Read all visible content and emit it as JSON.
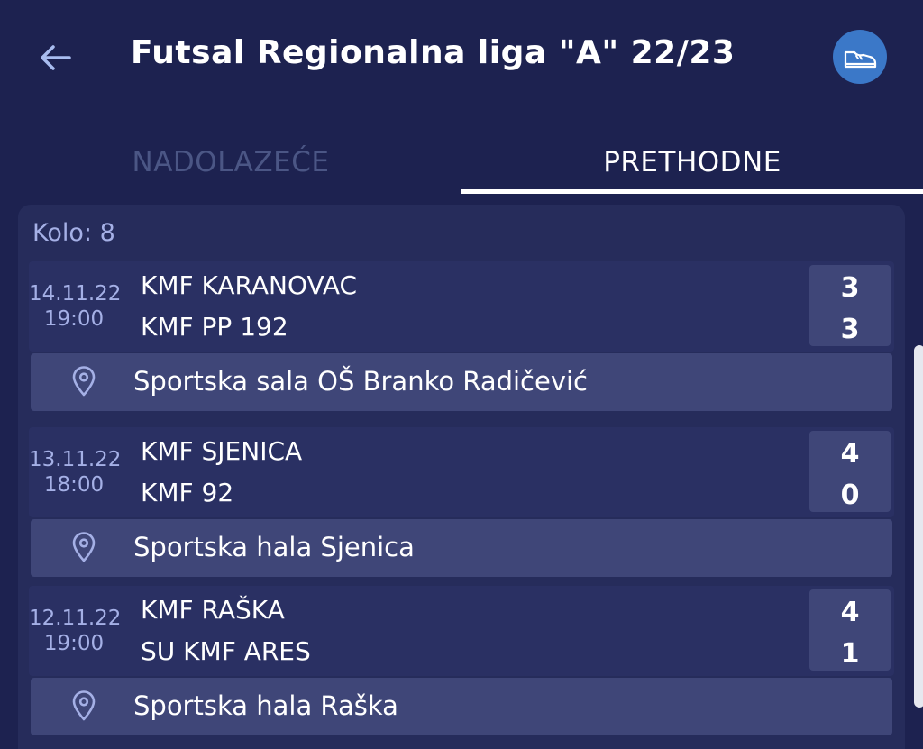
{
  "header": {
    "title": "Futsal Regionalna liga \"A\" 22/23",
    "back_icon": "arrow-left-icon",
    "sport_icon": "sneaker-icon",
    "sport_icon_bg": "#3b78c8"
  },
  "tabs": [
    {
      "label": "NADOLAZEĆE",
      "active": false
    },
    {
      "label": "PRETHODNE",
      "active": true
    }
  ],
  "round": {
    "label": "Kolo: 8"
  },
  "matches": [
    {
      "date": "14.11.22",
      "time": "19:00",
      "home_team": "KMF KARANOVAC",
      "away_team": "KMF PP 192",
      "home_score": "3",
      "away_score": "3",
      "venue": "Sportska sala OŠ Branko Radičević"
    },
    {
      "date": "13.11.22",
      "time": "18:00",
      "home_team": "KMF SJENICA",
      "away_team": "KMF 92",
      "home_score": "4",
      "away_score": "0",
      "venue": "Sportska hala Sjenica"
    },
    {
      "date": "12.11.22",
      "time": "19:00",
      "home_team": "KMF RAŠKA",
      "away_team": "SU KMF ARES",
      "home_score": "4",
      "away_score": "1",
      "venue": "Sportska hala Raška"
    }
  ],
  "colors": {
    "background": "#1d2250",
    "card": "#262c5b",
    "accent_text": "#a5b0e6",
    "inactive_tab": "#4b5685"
  }
}
